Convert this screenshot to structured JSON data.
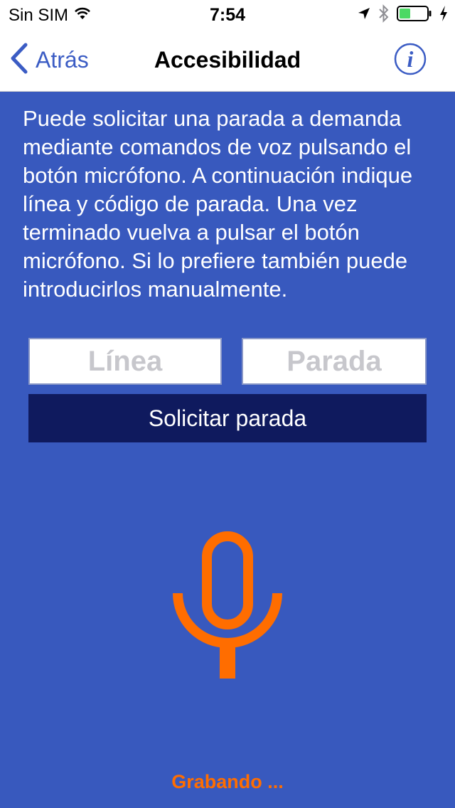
{
  "status_bar": {
    "carrier": "Sin SIM",
    "time": "7:54",
    "icons": [
      "wifi-icon",
      "location-arrow-icon",
      "bluetooth-icon",
      "battery-icon",
      "charging-bolt-icon"
    ],
    "battery_color": "#4cd964"
  },
  "nav": {
    "back_label": "Atrás",
    "title": "Accesibilidad",
    "info_icon": "info-icon",
    "accent_color": "#3b5cc4"
  },
  "main": {
    "background_color": "#3859be",
    "instructions": "Puede solicitar una parada a demanda mediante comandos de voz pulsando el botón micrófono. A continuación indique línea y código de parada. Una vez terminado vuelva a pulsar el botón micrófono. Si lo prefiere también puede introducirlos manualmente.",
    "linea_placeholder": "Línea",
    "parada_placeholder": "Parada",
    "submit_label": "Solicitar parada",
    "submit_color": "#0f1a5e",
    "mic_icon": "microphone-icon",
    "mic_color": "#ff6d00",
    "recording_status": "Grabando ..."
  }
}
